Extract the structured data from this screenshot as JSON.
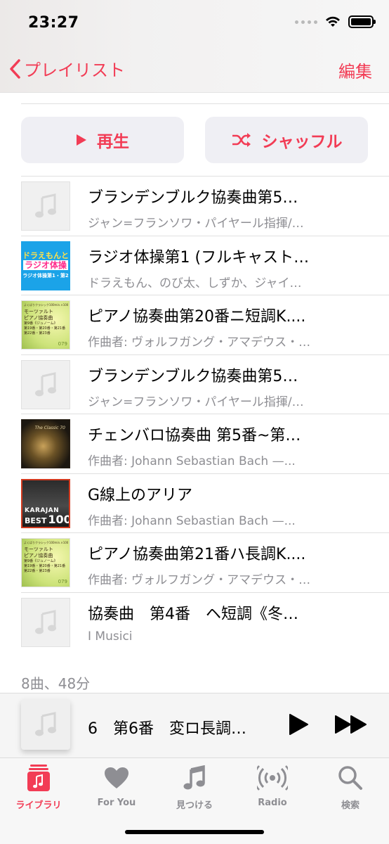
{
  "status": {
    "time": "23:27"
  },
  "nav": {
    "back_label": "プレイリスト",
    "edit_label": "編集"
  },
  "actions": {
    "play_label": "再生",
    "shuffle_label": "シャッフル"
  },
  "tracks": [
    {
      "title": "ブランデンブルク協奏曲第5…",
      "subtitle": "ジャン=フランソワ・パイヤール指揮/…",
      "art": "placeholder"
    },
    {
      "title": "ラジオ体操第1 (フルキャスト…",
      "subtitle": "ドラえもん、のび太、しずか、ジャイ…",
      "art": "doraemon",
      "art_text": [
        "ドラえもんと",
        "ラジオ体操",
        "ラジオ体操第1・第2"
      ]
    },
    {
      "title": "ピアノ協奏曲第20番ニ短調K....",
      "subtitle": "作曲者: ヴォルフガング・アマデウス・…",
      "art": "mozart",
      "art_text": [
        "よくばりクラシック100min.×100",
        "モーツァルト",
        "ピアノ協奏曲",
        "第9番《ジュノーム》",
        "第19番・第20番・第21番",
        "第22番・第23番",
        "079"
      ]
    },
    {
      "title": "ブランデンブルク協奏曲第5…",
      "subtitle": "ジャン=フランソワ・パイヤール指揮/…",
      "art": "placeholder"
    },
    {
      "title": "チェンバロ協奏曲 第5番~第…",
      "subtitle": "作曲者: Johann Sebastian Bach —...",
      "art": "gold",
      "art_text": [
        "The Classic 70"
      ]
    },
    {
      "title": "G線上のアリア",
      "subtitle": "作曲者: Johann Sebastian Bach —...",
      "art": "karajan",
      "art_text": [
        "KARAJAN",
        "BEST",
        "100"
      ]
    },
    {
      "title": "ピアノ協奏曲第21番ハ長調K....",
      "subtitle": "作曲者: ヴォルフガング・アマデウス・…",
      "art": "mozart",
      "art_text": [
        "よくばりクラシック100min.×100",
        "モーツァルト",
        "ピアノ協奏曲",
        "第9番《ジュノーム》",
        "第19番・第20番・第21番",
        "第22番・第23番",
        "079"
      ]
    },
    {
      "title": "協奏曲　第4番　ヘ短調《冬…",
      "subtitle": "I Musici",
      "art": "placeholder"
    }
  ],
  "summary": "8曲、48分",
  "mini_player": {
    "title": "6　第6番　変ロ長調…"
  },
  "tabs": [
    {
      "label": "ライブラリ",
      "icon": "library-icon",
      "active": true
    },
    {
      "label": "For You",
      "icon": "heart-icon",
      "active": false
    },
    {
      "label": "見つける",
      "icon": "music-note-icon",
      "active": false
    },
    {
      "label": "Radio",
      "icon": "radio-icon",
      "active": false
    },
    {
      "label": "検索",
      "icon": "search-icon",
      "active": false
    }
  ],
  "colors": {
    "accent": "#f23c55",
    "secondary_text": "#8e8e93"
  }
}
